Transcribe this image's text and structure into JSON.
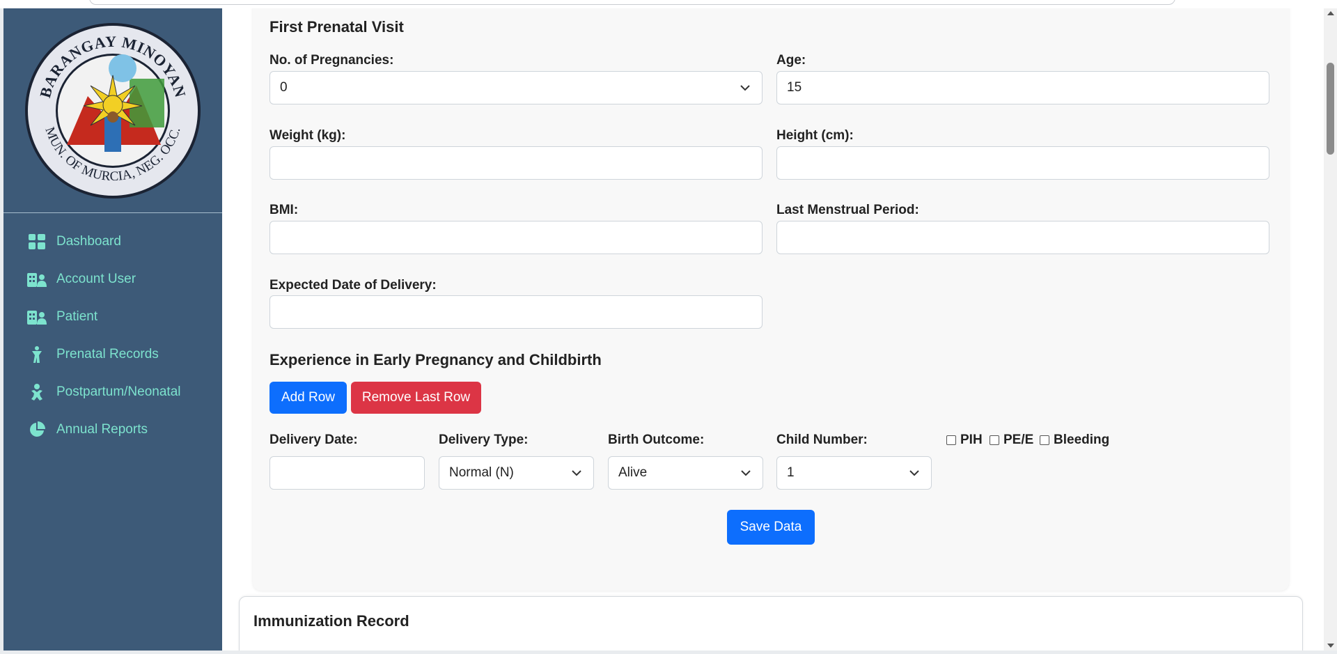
{
  "sidebar": {
    "logo": {
      "top_text": "BARANGAY MINOYAN",
      "bottom_text": "MUN. OF MURCIA, NEG. OCC."
    },
    "items": [
      {
        "label": "Dashboard",
        "icon": "dashboard-icon"
      },
      {
        "label": "Account User",
        "icon": "users-icon"
      },
      {
        "label": "Patient",
        "icon": "patient-icon"
      },
      {
        "label": "Prenatal Records",
        "icon": "prenatal-icon"
      },
      {
        "label": "Postpartum/Neonatal",
        "icon": "baby-icon"
      },
      {
        "label": "Annual Reports",
        "icon": "pie-chart-icon"
      }
    ]
  },
  "form": {
    "title": "First Prenatal Visit",
    "pregnancies_label": "No. of Pregnancies:",
    "pregnancies_value": "0",
    "age_label": "Age:",
    "age_value": "15",
    "weight_label": "Weight (kg):",
    "weight_value": "",
    "height_label": "Height (cm):",
    "height_value": "",
    "bmi_label": "BMI:",
    "bmi_value": "",
    "lmp_label": "Last Menstrual Period:",
    "lmp_value": "",
    "edd_label": "Expected Date of Delivery:",
    "edd_value": ""
  },
  "experience": {
    "title": "Experience in Early Pregnancy and Childbirth",
    "add_row": "Add Row",
    "remove_row": "Remove Last Row",
    "delivery_date_label": "Delivery Date:",
    "delivery_date_value": "",
    "delivery_type_label": "Delivery Type:",
    "delivery_type_value": "Normal (N)",
    "birth_outcome_label": "Birth Outcome:",
    "birth_outcome_value": "Alive",
    "child_number_label": "Child Number:",
    "child_number_value": "1",
    "checkboxes": [
      "PIH",
      "PE/E",
      "Bleeding"
    ]
  },
  "save_button": "Save Data",
  "immunization": {
    "title": "Immunization Record"
  }
}
